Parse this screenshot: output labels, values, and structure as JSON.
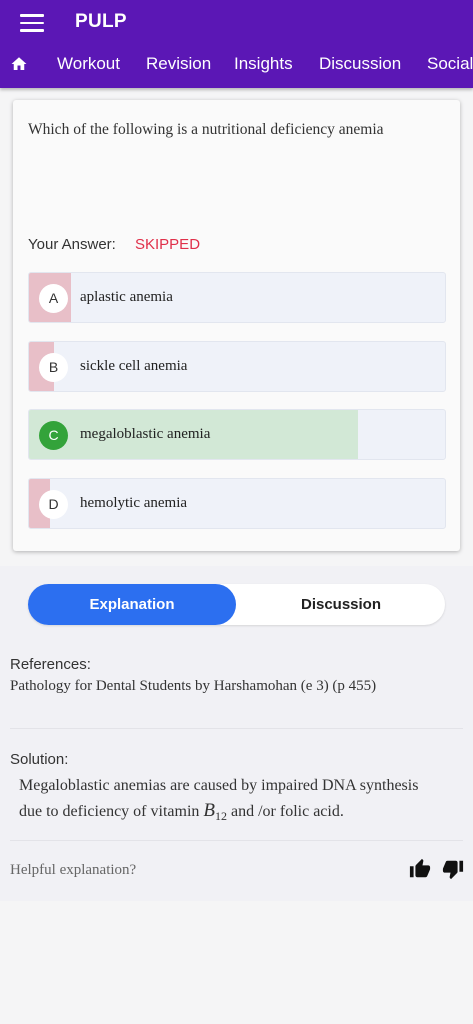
{
  "app": {
    "title": "PULP",
    "tabs": [
      "Workout",
      "Revision",
      "Insights",
      "Discussion",
      "Social"
    ]
  },
  "question": {
    "text": "Which of the following is a nutritional deficiency anemia",
    "your_answer_label": "Your Answer:",
    "your_answer_value": "SKIPPED",
    "options": [
      {
        "letter": "A",
        "text": "aplastic anemia",
        "percent": 10,
        "correct": false
      },
      {
        "letter": "B",
        "text": "sickle cell anemia",
        "percent": 6,
        "correct": false
      },
      {
        "letter": "C",
        "text": "megaloblastic anemia",
        "percent": 79,
        "correct": true
      },
      {
        "letter": "D",
        "text": "hemolytic anemia",
        "percent": 5,
        "correct": false
      }
    ]
  },
  "toggle": {
    "explanation": "Explanation",
    "discussion": "Discussion",
    "active": "Explanation"
  },
  "references": {
    "heading": "References:",
    "text": "Pathology for Dental Students by Harshamohan (e 3) (p 455)"
  },
  "solution": {
    "heading": "Solution:",
    "line1": "Megaloblastic anemias are caused by impaired DNA synthesis",
    "line2_prefix": "due to deficiency of vitamin ",
    "var": "B",
    "sub": "12",
    "line2_suffix": " and /or folic acid."
  },
  "feedback": {
    "prompt": "Helpful explanation?"
  },
  "colors": {
    "appbar": "#5b17b5",
    "skipped": "#e0304a",
    "wrong_fill": "#e8bfc8",
    "correct_fill": "#d2e8d6",
    "correct_badge": "#33a33a",
    "toggle_active": "#2c6ff0"
  }
}
